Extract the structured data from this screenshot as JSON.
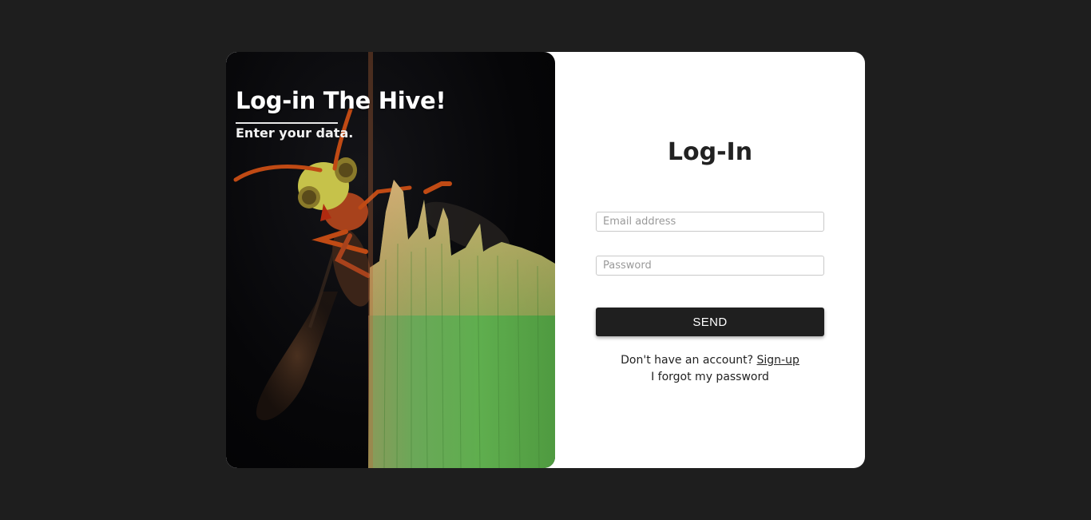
{
  "hero": {
    "title": "Log-in The Hive!",
    "subtitle": "Enter your data."
  },
  "form": {
    "title": "Log-In",
    "email_placeholder": "Email address",
    "password_placeholder": "Password",
    "send_label": "SEND",
    "no_account_text": "Don't have an account?",
    "signup_link": "Sign-up",
    "forgot_link": "I forgot my password"
  },
  "colors": {
    "page_background": "#1e1e1e",
    "card_background": "#ffffff",
    "button_background": "#1f1f1f",
    "leaf_green": "#6aa858"
  },
  "icons": {
    "hero_image": "wasp-on-grass-blade-photo"
  }
}
